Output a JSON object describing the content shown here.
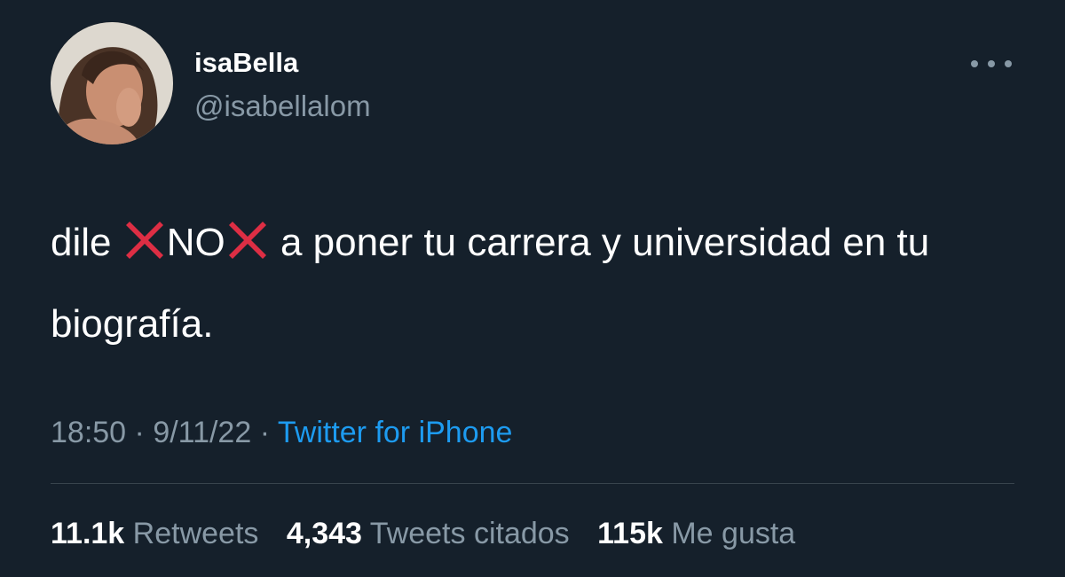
{
  "user": {
    "display_name": "isaBella",
    "handle": "@isabellalom"
  },
  "tweet": {
    "text_part1": "dile ",
    "text_no": "NO",
    "text_part2": " a poner tu carrera y universidad en tu biografía.",
    "icons": [
      "cross-mark-emoji",
      "cross-mark-emoji"
    ]
  },
  "meta": {
    "time": "18:50",
    "separator": "·",
    "date": "9/11/22",
    "source": "Twitter for iPhone"
  },
  "stats": {
    "retweets_count": "11.1k",
    "retweets_label": "Retweets",
    "quotes_count": "4,343",
    "quotes_label": "Tweets citados",
    "likes_count": "115k",
    "likes_label": "Me gusta"
  },
  "colors": {
    "background": "#15202b",
    "text": "#ffffff",
    "secondary": "#8899a6",
    "link": "#1d9bf0",
    "cross": "#dd2e44"
  }
}
